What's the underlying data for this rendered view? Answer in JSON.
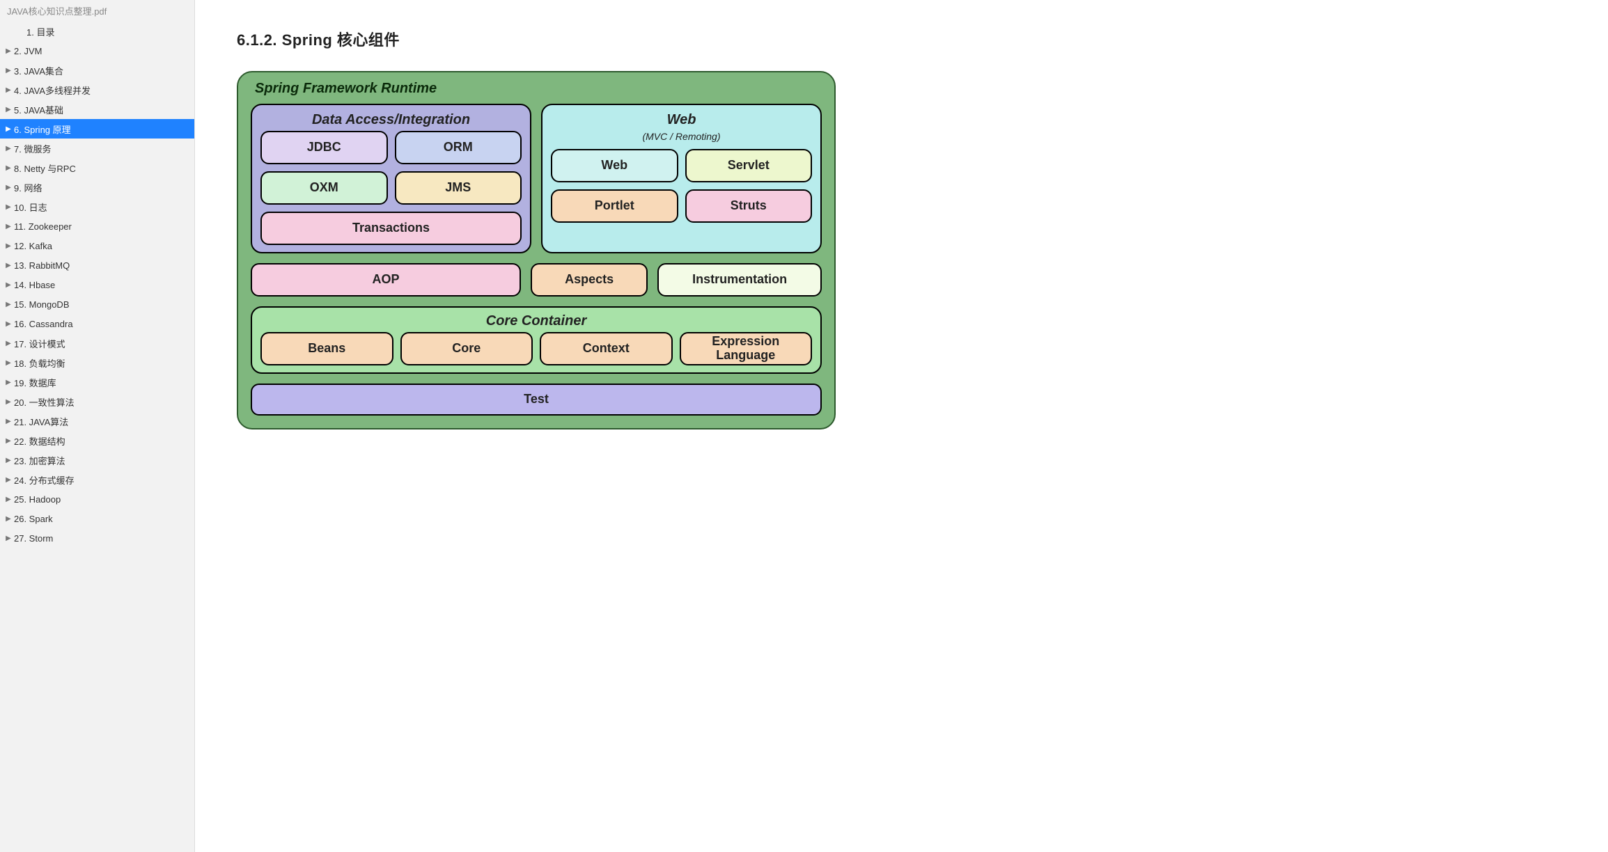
{
  "doc_title": "JAVA核心知识点整理.pdf",
  "toc": [
    {
      "label": "1. 目录",
      "indent": true,
      "selected": false,
      "chevron": false
    },
    {
      "label": "2. JVM",
      "indent": false,
      "selected": false,
      "chevron": true
    },
    {
      "label": "3. JAVA集合",
      "indent": false,
      "selected": false,
      "chevron": true
    },
    {
      "label": "4. JAVA多线程并发",
      "indent": false,
      "selected": false,
      "chevron": true
    },
    {
      "label": "5. JAVA基础",
      "indent": false,
      "selected": false,
      "chevron": true
    },
    {
      "label": "6. Spring 原理",
      "indent": false,
      "selected": true,
      "chevron": true
    },
    {
      "label": "7.   微服务",
      "indent": false,
      "selected": false,
      "chevron": true
    },
    {
      "label": "8. Netty 与RPC",
      "indent": false,
      "selected": false,
      "chevron": true
    },
    {
      "label": "9. 网络",
      "indent": false,
      "selected": false,
      "chevron": true
    },
    {
      "label": "10. 日志",
      "indent": false,
      "selected": false,
      "chevron": true
    },
    {
      "label": "11. Zookeeper",
      "indent": false,
      "selected": false,
      "chevron": true
    },
    {
      "label": "12. Kafka",
      "indent": false,
      "selected": false,
      "chevron": true
    },
    {
      "label": "13. RabbitMQ",
      "indent": false,
      "selected": false,
      "chevron": true
    },
    {
      "label": "14. Hbase",
      "indent": false,
      "selected": false,
      "chevron": true
    },
    {
      "label": "15. MongoDB",
      "indent": false,
      "selected": false,
      "chevron": true
    },
    {
      "label": "16. Cassandra",
      "indent": false,
      "selected": false,
      "chevron": true
    },
    {
      "label": "17. 设计模式",
      "indent": false,
      "selected": false,
      "chevron": true
    },
    {
      "label": "18. 负载均衡",
      "indent": false,
      "selected": false,
      "chevron": true
    },
    {
      "label": "19. 数据库",
      "indent": false,
      "selected": false,
      "chevron": true
    },
    {
      "label": "20. 一致性算法",
      "indent": false,
      "selected": false,
      "chevron": true
    },
    {
      "label": "21. JAVA算法",
      "indent": false,
      "selected": false,
      "chevron": true
    },
    {
      "label": "22. 数据结构",
      "indent": false,
      "selected": false,
      "chevron": true
    },
    {
      "label": "23. 加密算法",
      "indent": false,
      "selected": false,
      "chevron": true
    },
    {
      "label": "24. 分布式缓存",
      "indent": false,
      "selected": false,
      "chevron": true
    },
    {
      "label": "25. Hadoop",
      "indent": false,
      "selected": false,
      "chevron": true
    },
    {
      "label": "26. Spark",
      "indent": false,
      "selected": false,
      "chevron": true
    },
    {
      "label": "27. Storm",
      "indent": false,
      "selected": false,
      "chevron": true
    }
  ],
  "section_title": "6.1.2.  Spring 核心组件",
  "diagram": {
    "title": "Spring Framework Runtime",
    "data_access": {
      "title": "Data Access/Integration",
      "jdbc": "JDBC",
      "orm": "ORM",
      "oxm": "OXM",
      "jms": "JMS",
      "tx": "Transactions"
    },
    "web": {
      "title": "Web",
      "subtitle": "(MVC / Remoting)",
      "web": "Web",
      "servlet": "Servlet",
      "portlet": "Portlet",
      "struts": "Struts"
    },
    "aop": "AOP",
    "aspects": "Aspects",
    "instr": "Instrumentation",
    "core": {
      "title": "Core Container",
      "beans": "Beans",
      "coremod": "Core",
      "context": "Context",
      "el": "Expression Language"
    },
    "test": "Test"
  }
}
